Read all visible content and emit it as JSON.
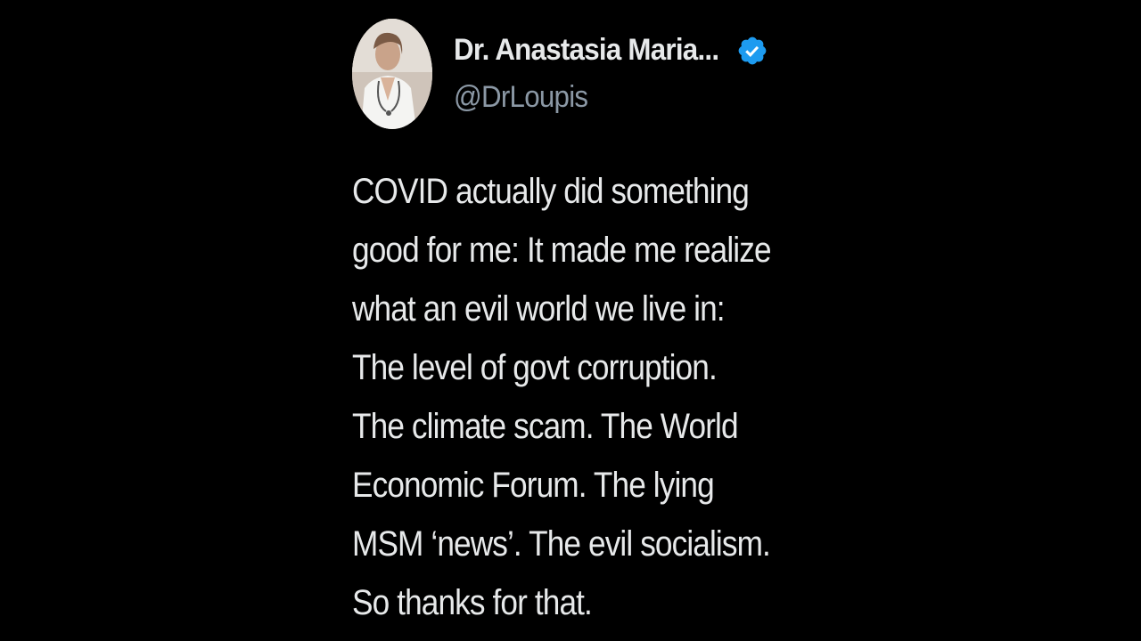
{
  "author": {
    "display_name": "Dr. Anastasia Maria...",
    "handle": "@DrLoupis",
    "verified": true,
    "verified_color": "#1d9bf0"
  },
  "tweet": {
    "lines": [
      "COVID actually did something",
      "good for me: It made me realize",
      "what an evil world we live in:",
      "The level of govt corruption.",
      "The climate scam. The World",
      "Economic Forum. The lying",
      "MSM ‘news’. The evil socialism.",
      "So thanks for that."
    ]
  },
  "colors": {
    "background": "#000000",
    "text": "#e7e9ea",
    "secondary_text": "#8b98a5"
  }
}
